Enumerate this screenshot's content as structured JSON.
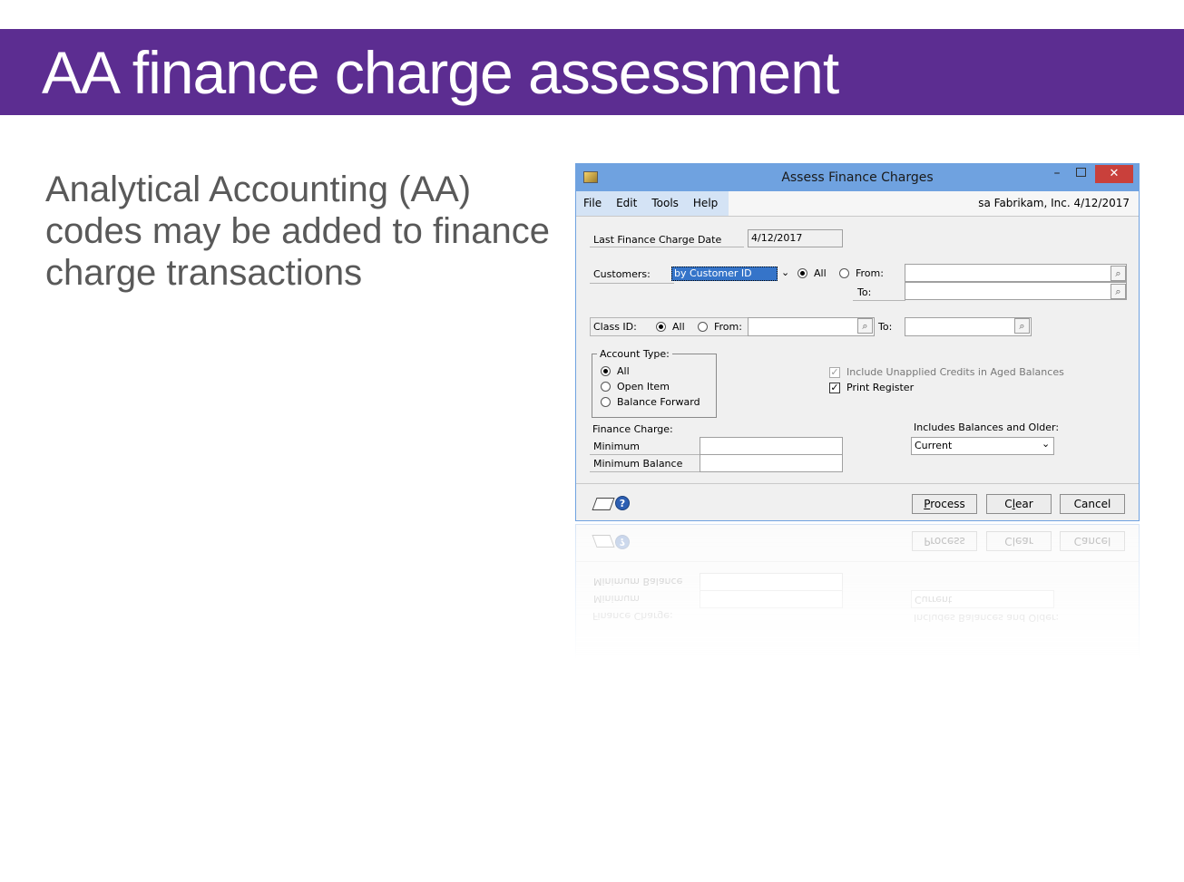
{
  "slide": {
    "title": "AA finance charge assessment",
    "body": "Analytical Accounting (AA) codes may be added to finance charge transactions"
  },
  "colors": {
    "title_bar": "#5c2d91",
    "window_frame": "#6fa2e0",
    "close_button": "#c9403b"
  },
  "window": {
    "title": "Assess Finance Charges",
    "controls": {
      "minimize": "–",
      "close": "✕"
    },
    "menu": [
      "File",
      "Edit",
      "Tools",
      "Help"
    ],
    "status": "sa  Fabrikam, Inc.  4/12/2017",
    "last_finance_charge_date_label": "Last Finance Charge Date",
    "last_finance_charge_date_value": "4/12/2017",
    "customers_label": "Customers:",
    "customers_sort": "by Customer ID",
    "all_label": "All",
    "from_label": "From:",
    "to_label": "To:",
    "class_id_label": "Class ID:",
    "account_type_label": "Account Type:",
    "account_types": [
      "All",
      "Open Item",
      "Balance Forward"
    ],
    "include_unapplied_label": "Include Unapplied Credits in Aged Balances",
    "print_register_label": "Print Register",
    "finance_charge_label": "Finance Charge:",
    "minimum_label": "Minimum",
    "minimum_balance_label": "Minimum Balance",
    "includes_balances_label": "Includes Balances and Older:",
    "includes_balances_value": "Current",
    "buttons": {
      "process_first": "P",
      "process_rest": "rocess",
      "clear_first": "C",
      "clear_mid": "l",
      "clear_rest": "ear",
      "cancel": "Cancel"
    },
    "icons": {
      "note": "note-icon",
      "help": "help-icon"
    }
  }
}
